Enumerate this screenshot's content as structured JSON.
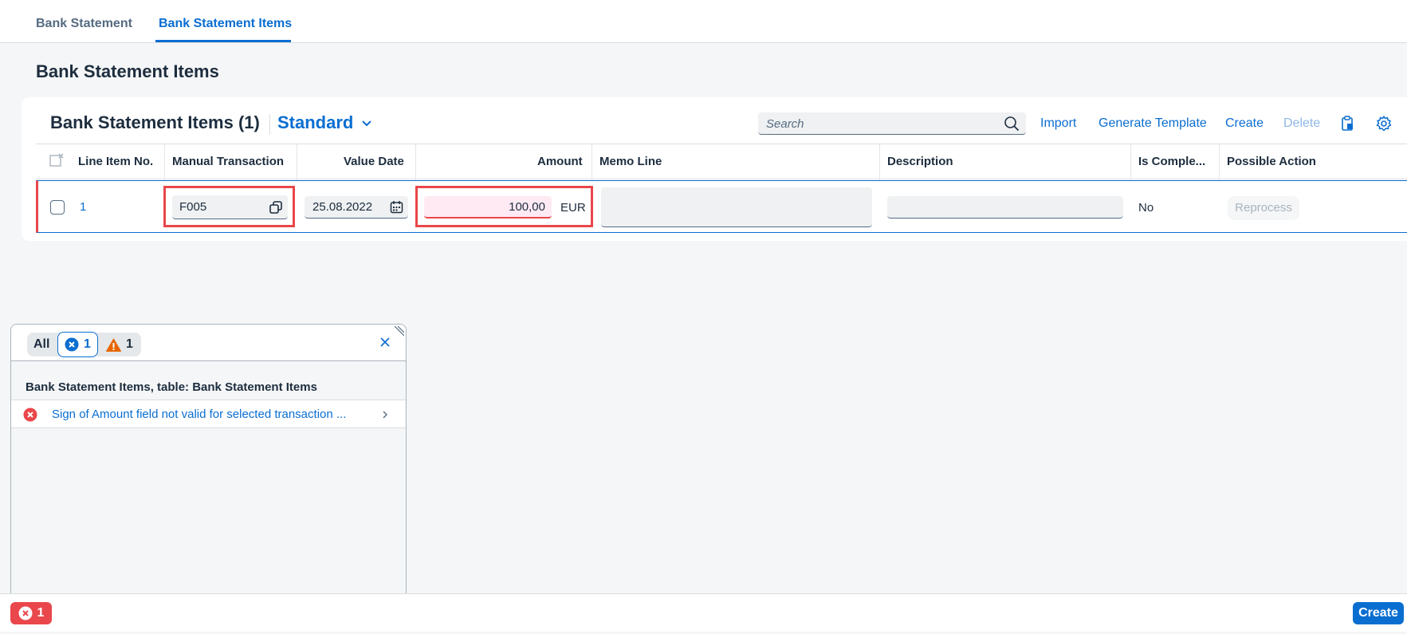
{
  "tabs": [
    {
      "label": "Bank Statement",
      "active": false
    },
    {
      "label": "Bank Statement Items",
      "active": true
    }
  ],
  "page_title": "Bank Statement Items",
  "table": {
    "title": "Bank Statement Items (1)",
    "variant": "Standard",
    "search_placeholder": "Search",
    "toolbar": {
      "import": "Import",
      "generate_template": "Generate Template",
      "create": "Create",
      "delete": "Delete"
    },
    "columns": [
      "Line Item No.",
      "Manual Transaction",
      "Value Date",
      "Amount",
      "Memo Line",
      "Description",
      "Is Comple...",
      "Possible Action"
    ],
    "rows": [
      {
        "line_item_no": "1",
        "manual_transaction": "F005",
        "value_date": "25.08.2022",
        "amount": "100,00",
        "currency": "EUR",
        "memo_line": "",
        "description": "",
        "is_complete": "No",
        "possible_action": "Reprocess"
      }
    ]
  },
  "message_popover": {
    "filter_all": "All",
    "error_count": "1",
    "warning_count": "1",
    "group_title": "Bank Statement Items, table: Bank Statement Items",
    "items": [
      {
        "type": "error",
        "text": "Sign of Amount field not valid for selected transaction ..."
      }
    ]
  },
  "footer": {
    "error_count": "1",
    "create_label": "Create"
  },
  "colors": {
    "accent": "#0a6ed1",
    "error": "#e9474b",
    "warning": "#e76500"
  }
}
